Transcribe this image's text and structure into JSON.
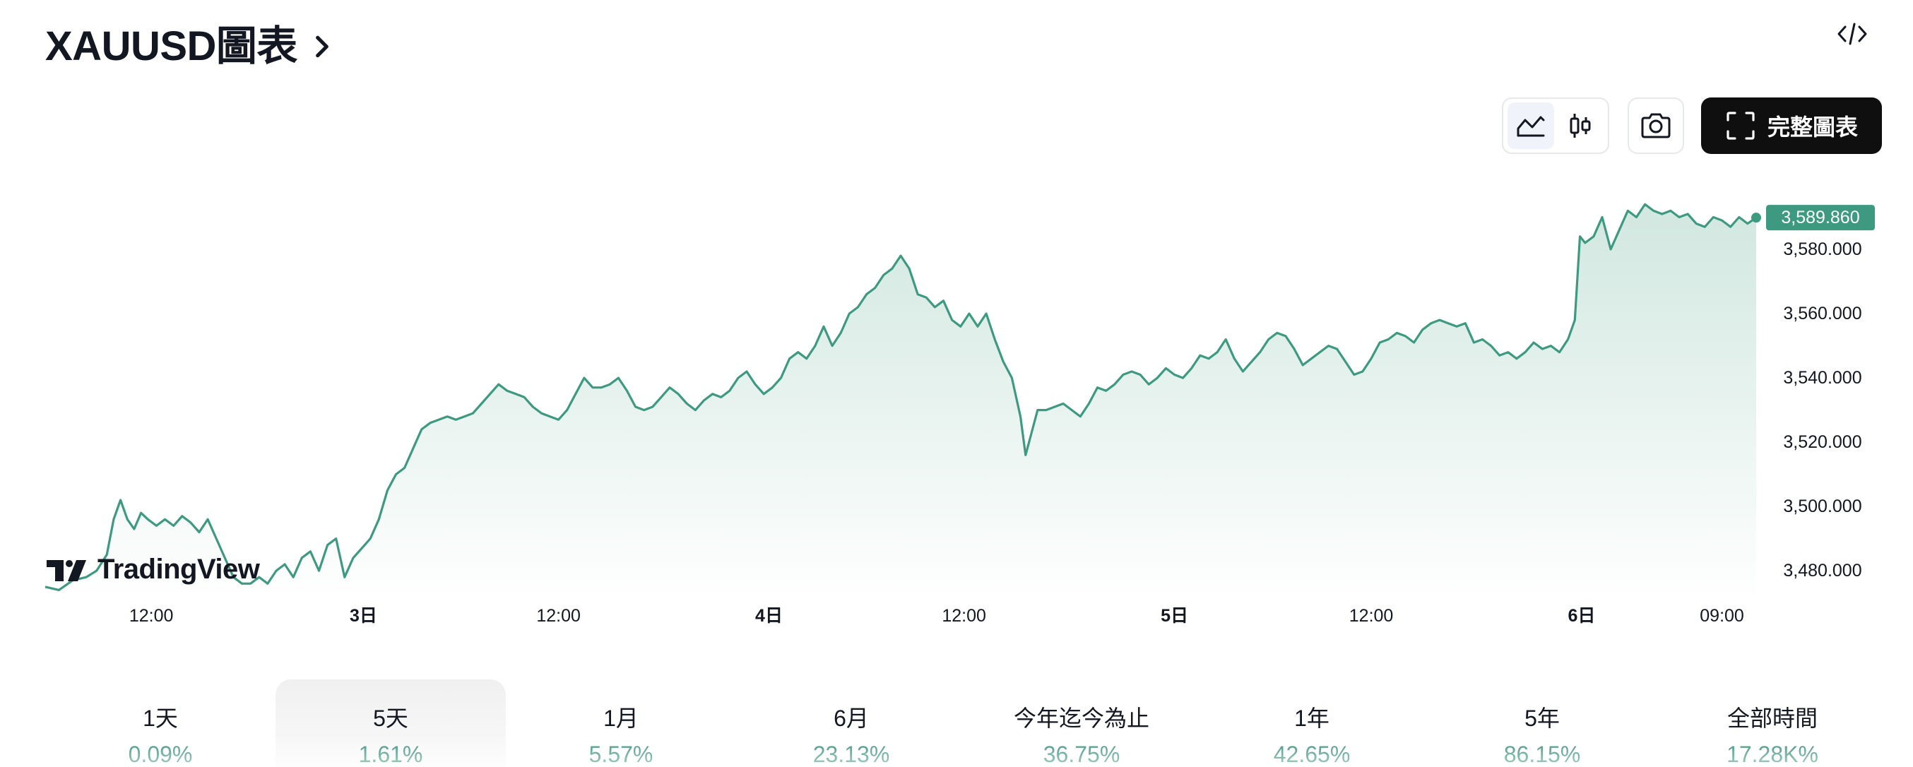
{
  "header": {
    "symbol_title": "XAUUSD圖表",
    "embed_icon": "code-icon"
  },
  "toolbar": {
    "line_chart_icon": "area-chart-icon",
    "candle_chart_icon": "candlestick-icon",
    "snapshot_icon": "camera-icon",
    "fullscreen_icon": "expand-frame-icon",
    "full_chart_label": "完整圖表"
  },
  "logo": {
    "text": "TradingView"
  },
  "colors": {
    "line": "#3d9a80",
    "fill_top": "#cfe6de",
    "fill_bottom": "#ffffff",
    "price_tag": "#3d9a80",
    "period_value": "#2b8a6e"
  },
  "chart_data": {
    "type": "area",
    "ylim": [
      3473,
      3600
    ],
    "y_ticks": [
      {
        "value": 3580,
        "label": "3,580.000"
      },
      {
        "value": 3560,
        "label": "3,560.000"
      },
      {
        "value": 3540,
        "label": "3,540.000"
      },
      {
        "value": 3520,
        "label": "3,520.000"
      },
      {
        "value": 3500,
        "label": "3,500.000"
      },
      {
        "value": 3480,
        "label": "3,480.000"
      }
    ],
    "x_ticks": [
      {
        "t": 0.062,
        "label": "12:00",
        "bold": false
      },
      {
        "t": 0.186,
        "label": "3日",
        "bold": true
      },
      {
        "t": 0.3,
        "label": "12:00",
        "bold": false
      },
      {
        "t": 0.423,
        "label": "4日",
        "bold": true
      },
      {
        "t": 0.537,
        "label": "12:00",
        "bold": false
      },
      {
        "t": 0.66,
        "label": "5日",
        "bold": true
      },
      {
        "t": 0.775,
        "label": "12:00",
        "bold": false
      },
      {
        "t": 0.898,
        "label": "6日",
        "bold": true
      },
      {
        "t": 0.98,
        "label": "09:00",
        "bold": false
      }
    ],
    "last_price_label": "3,589.860",
    "last_price": 3589.86,
    "series": [
      {
        "points": [
          [
            0,
            3475
          ],
          [
            0.008,
            3474
          ],
          [
            0.016,
            3477
          ],
          [
            0.024,
            3478
          ],
          [
            0.03,
            3480
          ],
          [
            0.036,
            3485
          ],
          [
            0.04,
            3496
          ],
          [
            0.044,
            3502
          ],
          [
            0.048,
            3496
          ],
          [
            0.052,
            3493
          ],
          [
            0.056,
            3498
          ],
          [
            0.06,
            3496
          ],
          [
            0.065,
            3494
          ],
          [
            0.07,
            3496
          ],
          [
            0.075,
            3494
          ],
          [
            0.08,
            3497
          ],
          [
            0.085,
            3495
          ],
          [
            0.09,
            3492
          ],
          [
            0.095,
            3496
          ],
          [
            0.1,
            3490
          ],
          [
            0.105,
            3484
          ],
          [
            0.11,
            3478
          ],
          [
            0.115,
            3476
          ],
          [
            0.12,
            3476
          ],
          [
            0.125,
            3478
          ],
          [
            0.13,
            3476
          ],
          [
            0.135,
            3480
          ],
          [
            0.14,
            3482
          ],
          [
            0.145,
            3478
          ],
          [
            0.15,
            3484
          ],
          [
            0.155,
            3486
          ],
          [
            0.16,
            3480
          ],
          [
            0.165,
            3488
          ],
          [
            0.17,
            3490
          ],
          [
            0.175,
            3478
          ],
          [
            0.18,
            3484
          ],
          [
            0.185,
            3487
          ],
          [
            0.19,
            3490
          ],
          [
            0.195,
            3496
          ],
          [
            0.2,
            3505
          ],
          [
            0.205,
            3510
          ],
          [
            0.21,
            3512
          ],
          [
            0.215,
            3518
          ],
          [
            0.22,
            3524
          ],
          [
            0.225,
            3526
          ],
          [
            0.23,
            3527
          ],
          [
            0.235,
            3528
          ],
          [
            0.24,
            3527
          ],
          [
            0.245,
            3528
          ],
          [
            0.25,
            3529
          ],
          [
            0.255,
            3532
          ],
          [
            0.26,
            3535
          ],
          [
            0.265,
            3538
          ],
          [
            0.27,
            3536
          ],
          [
            0.275,
            3535
          ],
          [
            0.28,
            3534
          ],
          [
            0.285,
            3531
          ],
          [
            0.29,
            3529
          ],
          [
            0.295,
            3528
          ],
          [
            0.3,
            3527
          ],
          [
            0.305,
            3530
          ],
          [
            0.31,
            3535
          ],
          [
            0.315,
            3540
          ],
          [
            0.32,
            3537
          ],
          [
            0.325,
            3537
          ],
          [
            0.33,
            3538
          ],
          [
            0.335,
            3540
          ],
          [
            0.34,
            3536
          ],
          [
            0.345,
            3531
          ],
          [
            0.35,
            3530
          ],
          [
            0.355,
            3531
          ],
          [
            0.36,
            3534
          ],
          [
            0.365,
            3537
          ],
          [
            0.37,
            3535
          ],
          [
            0.375,
            3532
          ],
          [
            0.38,
            3530
          ],
          [
            0.385,
            3533
          ],
          [
            0.39,
            3535
          ],
          [
            0.395,
            3534
          ],
          [
            0.4,
            3536
          ],
          [
            0.405,
            3540
          ],
          [
            0.41,
            3542
          ],
          [
            0.415,
            3538
          ],
          [
            0.42,
            3535
          ],
          [
            0.425,
            3537
          ],
          [
            0.43,
            3540
          ],
          [
            0.435,
            3546
          ],
          [
            0.44,
            3548
          ],
          [
            0.445,
            3546
          ],
          [
            0.45,
            3550
          ],
          [
            0.455,
            3556
          ],
          [
            0.46,
            3550
          ],
          [
            0.465,
            3554
          ],
          [
            0.47,
            3560
          ],
          [
            0.475,
            3562
          ],
          [
            0.48,
            3566
          ],
          [
            0.485,
            3568
          ],
          [
            0.49,
            3572
          ],
          [
            0.495,
            3574
          ],
          [
            0.5,
            3578
          ],
          [
            0.505,
            3574
          ],
          [
            0.51,
            3566
          ],
          [
            0.515,
            3565
          ],
          [
            0.52,
            3562
          ],
          [
            0.525,
            3564
          ],
          [
            0.53,
            3558
          ],
          [
            0.535,
            3556
          ],
          [
            0.54,
            3560
          ],
          [
            0.545,
            3556
          ],
          [
            0.55,
            3560
          ],
          [
            0.555,
            3552
          ],
          [
            0.56,
            3545
          ],
          [
            0.565,
            3540
          ],
          [
            0.57,
            3528
          ],
          [
            0.573,
            3516
          ],
          [
            0.576,
            3522
          ],
          [
            0.58,
            3530
          ],
          [
            0.585,
            3530
          ],
          [
            0.59,
            3531
          ],
          [
            0.595,
            3532
          ],
          [
            0.6,
            3530
          ],
          [
            0.605,
            3528
          ],
          [
            0.61,
            3532
          ],
          [
            0.615,
            3537
          ],
          [
            0.62,
            3536
          ],
          [
            0.625,
            3538
          ],
          [
            0.63,
            3541
          ],
          [
            0.635,
            3542
          ],
          [
            0.64,
            3541
          ],
          [
            0.645,
            3538
          ],
          [
            0.65,
            3540
          ],
          [
            0.655,
            3543
          ],
          [
            0.66,
            3541
          ],
          [
            0.665,
            3540
          ],
          [
            0.67,
            3543
          ],
          [
            0.675,
            3547
          ],
          [
            0.68,
            3546
          ],
          [
            0.685,
            3548
          ],
          [
            0.69,
            3552
          ],
          [
            0.695,
            3546
          ],
          [
            0.7,
            3542
          ],
          [
            0.705,
            3545
          ],
          [
            0.71,
            3548
          ],
          [
            0.715,
            3552
          ],
          [
            0.72,
            3554
          ],
          [
            0.725,
            3553
          ],
          [
            0.73,
            3549
          ],
          [
            0.735,
            3544
          ],
          [
            0.74,
            3546
          ],
          [
            0.745,
            3548
          ],
          [
            0.75,
            3550
          ],
          [
            0.755,
            3549
          ],
          [
            0.76,
            3545
          ],
          [
            0.765,
            3541
          ],
          [
            0.77,
            3542
          ],
          [
            0.775,
            3546
          ],
          [
            0.78,
            3551
          ],
          [
            0.785,
            3552
          ],
          [
            0.79,
            3554
          ],
          [
            0.795,
            3553
          ],
          [
            0.8,
            3551
          ],
          [
            0.805,
            3555
          ],
          [
            0.81,
            3557
          ],
          [
            0.815,
            3558
          ],
          [
            0.82,
            3557
          ],
          [
            0.825,
            3556
          ],
          [
            0.83,
            3557
          ],
          [
            0.835,
            3551
          ],
          [
            0.84,
            3552
          ],
          [
            0.845,
            3550
          ],
          [
            0.85,
            3547
          ],
          [
            0.855,
            3548
          ],
          [
            0.86,
            3546
          ],
          [
            0.865,
            3548
          ],
          [
            0.87,
            3551
          ],
          [
            0.875,
            3549
          ],
          [
            0.88,
            3550
          ],
          [
            0.885,
            3548
          ],
          [
            0.89,
            3552
          ],
          [
            0.894,
            3558
          ],
          [
            0.897,
            3584
          ],
          [
            0.9,
            3582
          ],
          [
            0.905,
            3584
          ],
          [
            0.91,
            3590
          ],
          [
            0.915,
            3580
          ],
          [
            0.92,
            3586
          ],
          [
            0.925,
            3592
          ],
          [
            0.93,
            3590
          ],
          [
            0.935,
            3594
          ],
          [
            0.94,
            3592
          ],
          [
            0.945,
            3591
          ],
          [
            0.95,
            3592
          ],
          [
            0.955,
            3590
          ],
          [
            0.96,
            3591
          ],
          [
            0.965,
            3588
          ],
          [
            0.97,
            3587
          ],
          [
            0.975,
            3590
          ],
          [
            0.98,
            3589
          ],
          [
            0.985,
            3587
          ],
          [
            0.99,
            3590
          ],
          [
            0.995,
            3588
          ],
          [
            1,
            3589.86
          ]
        ]
      }
    ]
  },
  "periods": [
    {
      "label": "1天",
      "value": "0.09%",
      "active": false
    },
    {
      "label": "5天",
      "value": "1.61%",
      "active": true
    },
    {
      "label": "1月",
      "value": "5.57%",
      "active": false
    },
    {
      "label": "6月",
      "value": "23.13%",
      "active": false
    },
    {
      "label": "今年迄今為止",
      "value": "36.75%",
      "active": false
    },
    {
      "label": "1年",
      "value": "42.65%",
      "active": false
    },
    {
      "label": "5年",
      "value": "86.15%",
      "active": false
    },
    {
      "label": "全部時間",
      "value": "17.28K%",
      "active": false
    }
  ]
}
